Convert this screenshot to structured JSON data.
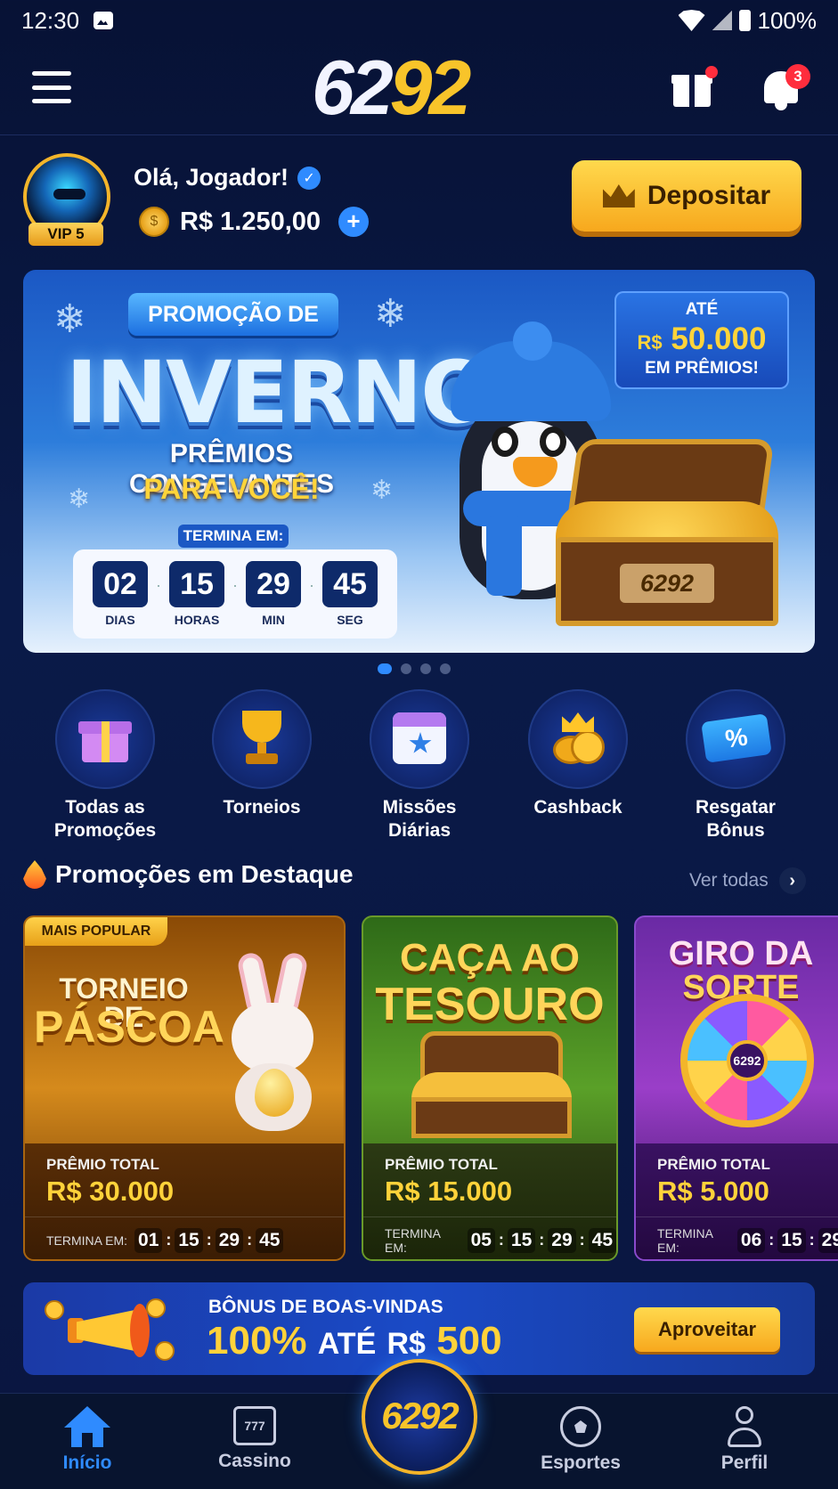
{
  "status_bar": {
    "time": "12:30",
    "battery": "100%"
  },
  "header": {
    "logo_part1": "62",
    "logo_part2": "92",
    "notifications_count": "3"
  },
  "user": {
    "greeting": "Olá, Jogador!",
    "vip": "VIP 5",
    "balance": "R$ 1.250,00",
    "deposit_label": "Depositar"
  },
  "hero": {
    "pill": "PROMOÇÃO DE",
    "title": "INVERNO",
    "subtitle1": "PRÊMIOS CONGELANTES",
    "subtitle2": "PARA VOCÊ!",
    "ends_label": "TERMINA EM:",
    "countdown": [
      {
        "value": "02",
        "label": "DIAS"
      },
      {
        "value": "15",
        "label": "HORAS"
      },
      {
        "value": "29",
        "label": "MIN"
      },
      {
        "value": "45",
        "label": "SEG"
      }
    ],
    "prize_top": "ATÉ",
    "prize_currency": "R$",
    "prize_amount": "50.000",
    "prize_bottom": "EM PRÊMIOS!",
    "chest_text": "6292",
    "pager_total": 4,
    "pager_active": 1
  },
  "quick_menu": [
    {
      "line1": "Todas as",
      "line2": "Promoções",
      "icon": "gift-icon"
    },
    {
      "line1": "Torneios",
      "line2": "",
      "icon": "trophy-icon"
    },
    {
      "line1": "Missões",
      "line2": "Diárias",
      "icon": "calendar-star-icon"
    },
    {
      "line1": "Cashback",
      "line2": "",
      "icon": "coins-crown-icon"
    },
    {
      "line1": "Resgatar",
      "line2": "Bônus",
      "icon": "percent-ticket-icon"
    }
  ],
  "featured": {
    "title": "Promoções em Destaque",
    "see_all": "Ver todas",
    "cards": [
      {
        "badge": "MAIS POPULAR",
        "headline1": "TORNEIO DE",
        "headline2": "PÁSCOA",
        "prize_label": "PRÊMIO TOTAL",
        "prize": "R$ 30.000",
        "ends_label": "TERMINA EM:",
        "t1": "01",
        "t2": "15",
        "t3": "29",
        "t4": "45"
      },
      {
        "headline1": "CAÇA AO",
        "headline2": "TESOURO",
        "prize_label": "PRÊMIO TOTAL",
        "prize": "R$ 15.000",
        "ends_label": "TERMINA EM:",
        "t1": "05",
        "t2": "15",
        "t3": "29",
        "t4": "45"
      },
      {
        "headline1": "GIRO DA",
        "headline2": "SORTE",
        "prize_label": "PRÊMIO TOTAL",
        "prize": "R$ 5.000",
        "ends_label": "TERMINA EM:",
        "t1": "06",
        "t2": "15",
        "t3": "29",
        "wheel_text": "6292"
      }
    ]
  },
  "welcome": {
    "line1": "BÔNUS DE BOAS-VINDAS",
    "percent": "100%",
    "upto": "ATÉ",
    "currency": "R$",
    "amount": "500",
    "cta": "Aproveitar"
  },
  "bottom_nav": {
    "items": [
      "Início",
      "Cassino",
      "Esportes",
      "Perfil"
    ],
    "center": "6292",
    "slot_text": "777"
  }
}
